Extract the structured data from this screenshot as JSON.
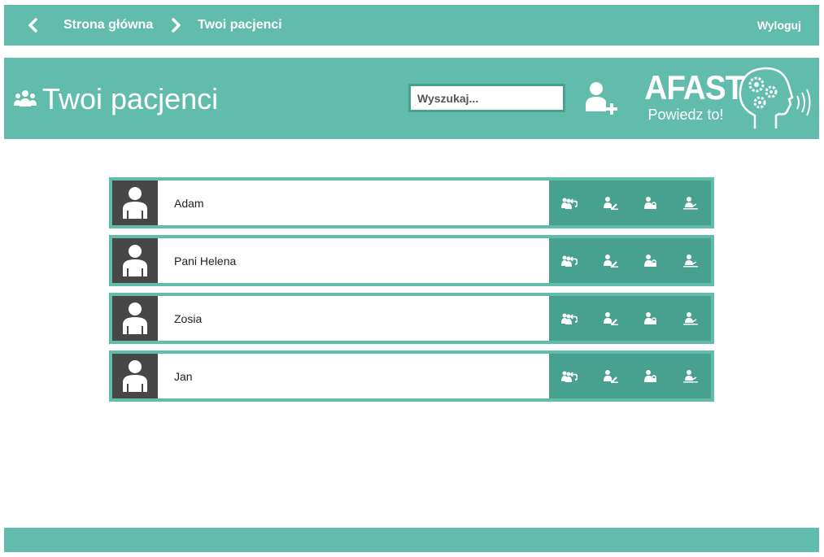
{
  "topbar": {
    "breadcrumb_home": "Strona główna",
    "breadcrumb_current": "Twoi pacjenci",
    "logout": "Wyloguj"
  },
  "header": {
    "title": "Twoi pacjenci",
    "search_placeholder": "Wyszukaj..."
  },
  "brand": {
    "name": "AFAST",
    "tagline": "Powiedz to!"
  },
  "patients": [
    {
      "name": "Adam"
    },
    {
      "name": "Pani Helena"
    },
    {
      "name": "Zosia"
    },
    {
      "name": "Jan"
    }
  ],
  "row_actions": [
    "users-return-icon",
    "user-edit-icon",
    "user-lock-icon",
    "user-sign-icon"
  ],
  "colors": {
    "primary": "#62bcac",
    "primary_dark": "#48a08f",
    "avatar_bg": "#474747"
  }
}
